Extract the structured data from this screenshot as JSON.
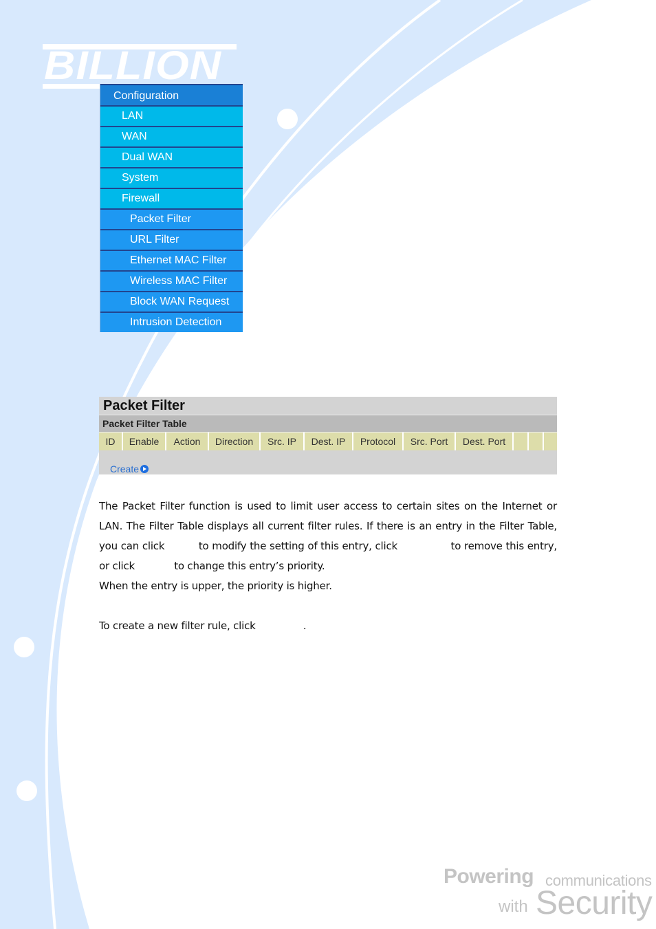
{
  "brand": {
    "logo_text": "BILLION",
    "slogan_line1_bold": "Powering",
    "slogan_line1_rest": "communications",
    "slogan_line2_small": "with",
    "slogan_line2_large": "Security"
  },
  "menu": {
    "items": [
      {
        "label": "Configuration",
        "level": 0
      },
      {
        "label": "LAN",
        "level": 1
      },
      {
        "label": "WAN",
        "level": 1
      },
      {
        "label": "Dual WAN",
        "level": 1
      },
      {
        "label": "System",
        "level": 1
      },
      {
        "label": "Firewall",
        "level": 1
      },
      {
        "label": "Packet Filter",
        "level": 2
      },
      {
        "label": "URL Filter",
        "level": 2
      },
      {
        "label": "Ethernet MAC Filter",
        "level": 2
      },
      {
        "label": "Wireless MAC Filter",
        "level": 2
      },
      {
        "label": "Block WAN Request",
        "level": 2
      },
      {
        "label": "Intrusion Detection",
        "level": 2
      }
    ]
  },
  "panel": {
    "title": "Packet Filter",
    "subtitle": "Packet Filter Table",
    "columns": [
      "ID",
      "Enable",
      "Action",
      "Direction",
      "Src. IP",
      "Dest. IP",
      "Protocol",
      "Src. Port",
      "Dest. Port",
      "",
      "",
      ""
    ],
    "create_label": "Create"
  },
  "description": {
    "para1_a": "The Packet Filter function is used to limit user access to certain sites on the Internet or LAN. The Filter Table displays all current filter rules. If there is an entry in the Filter Table, you can click",
    "para1_b": "to modify the setting of this entry, click",
    "para1_c": "to remove this entry, or click",
    "para1_d": "to change this entry’s priority.",
    "para2": "When the entry is upper, the priority is higher.",
    "para3_a": "To create a new filter rule, click",
    "para3_b": "."
  },
  "colors": {
    "menu_header": "#1a80d6",
    "menu_level1": "#00b9ea",
    "menu_level2": "#1e98f2",
    "menu_divider": "#22458f",
    "panel_title_bg": "#d3d3d3",
    "panel_sub_bg": "#bababa",
    "column_header_bg": "#ddddaa",
    "link": "#2a6fd0",
    "background_swoosh": "#d8e9fd"
  }
}
